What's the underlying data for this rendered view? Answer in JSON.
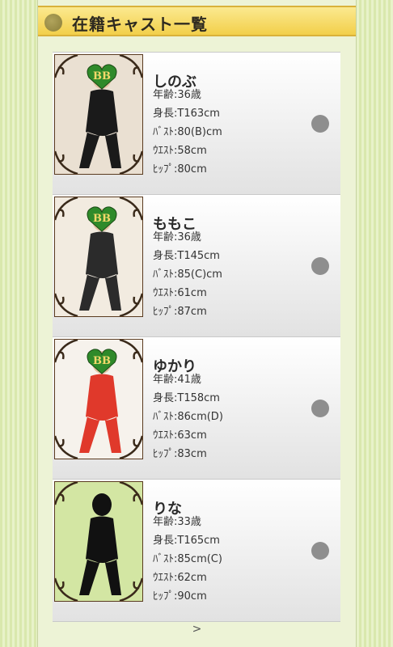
{
  "header": {
    "title": "在籍キャスト一覧"
  },
  "cast": [
    {
      "name": "しのぶ",
      "age": "年齢:36歳",
      "height": "身長:T163cm",
      "bust": "ﾊﾞｽﾄ:80(B)cm",
      "waist": "ｳｴｽﾄ:58cm",
      "hip": "ﾋｯﾌﾟ:80cm",
      "outfit": "#1a1a1a",
      "bg": "#eae0d2",
      "logo": "BB"
    },
    {
      "name": "ももこ",
      "age": "年齢:36歳",
      "height": "身長:T145cm",
      "bust": "ﾊﾞｽﾄ:85(C)cm",
      "waist": "ｳｴｽﾄ:61cm",
      "hip": "ﾋｯﾌﾟ:87cm",
      "outfit": "#2b2b2b",
      "bg": "#f2ebe0",
      "logo": "BB"
    },
    {
      "name": "ゆかり",
      "age": "年齢:41歳",
      "height": "身長:T158cm",
      "bust": "ﾊﾞｽﾄ:86cm(D)",
      "waist": "ｳｴｽﾄ:63cm",
      "hip": "ﾋｯﾌﾟ:83cm",
      "outfit": "#e0392b",
      "bg": "#f6f2ec",
      "logo": "BB"
    },
    {
      "name": "りな",
      "age": "年齢:33歳",
      "height": "身長:T165cm",
      "bust": "ﾊﾞｽﾄ:85cm(C)",
      "waist": "ｳｴｽﾄ:62cm",
      "hip": "ﾋｯﾌﾟ:90cm",
      "outfit": "#111111",
      "bg": "#d3e6a3",
      "logo": ""
    }
  ],
  "pagination": {
    "next": ">"
  },
  "icons": {
    "header": "bullet-circle-icon",
    "row": "arrow-circle-icon"
  }
}
